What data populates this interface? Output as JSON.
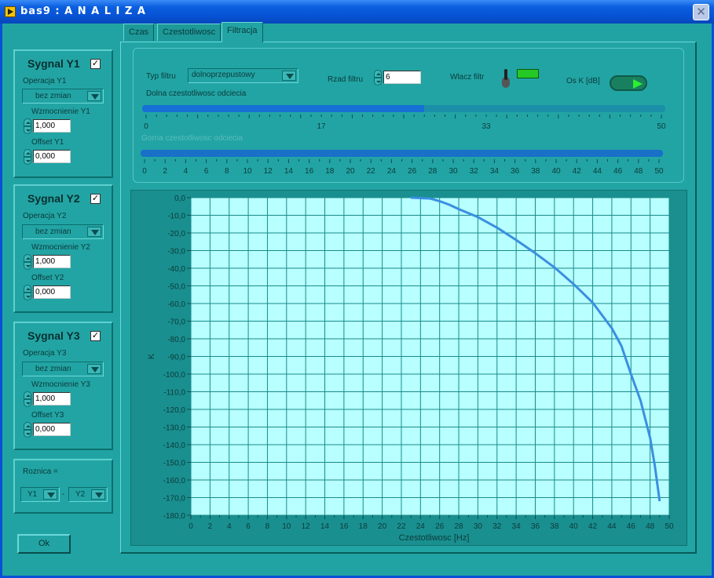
{
  "window": {
    "title": "bas9 : A N A L I Z A",
    "close_glyph": "✕"
  },
  "tabs": [
    {
      "label": "Czas",
      "active": false
    },
    {
      "label": "Czestotliwosc",
      "active": false
    },
    {
      "label": "Filtracja",
      "active": true
    }
  ],
  "signals": [
    {
      "title": "Sygnal Y1",
      "checked": true,
      "op_label": "Operacja Y1",
      "op_value": "bez zmian",
      "gain_label": "Wzmocnienie Y1",
      "gain_value": "1,000",
      "offset_label": "Offset Y1",
      "offset_value": "0,000"
    },
    {
      "title": "Sygnal Y2",
      "checked": true,
      "op_label": "Operacja Y2",
      "op_value": "bez zmian",
      "gain_label": "Wzmocnienie Y2",
      "gain_value": "1,000",
      "offset_label": "Offset Y2",
      "offset_value": "0,000"
    },
    {
      "title": "Sygnal Y3",
      "checked": true,
      "op_label": "Operacja Y3",
      "op_value": "bez zmian",
      "gain_label": "Wzmocnienie Y3",
      "gain_value": "1,000",
      "offset_label": "Offset Y3",
      "offset_value": "0,000"
    }
  ],
  "difference": {
    "label": "Roznica =",
    "left": "Y1",
    "separator": "-",
    "right": "Y2"
  },
  "ok_label": "Ok",
  "filter": {
    "type_label": "Typ filtru",
    "type_value": "dolnoprzepustowy",
    "order_label": "Rzad filtru",
    "order_value": "6",
    "enable_label": "Wlacz filtr",
    "axis_label": "Os K [dB]",
    "lower_cutoff_label": "Dolna czestotliwosc odciecia",
    "lower_cutoff_value": 27,
    "lower_ticks": [
      "0",
      "17",
      "33",
      "50"
    ],
    "upper_cutoff_label": "Gorna czestotliwosc odciecia",
    "upper_ticks": [
      "0",
      "2",
      "4",
      "6",
      "8",
      "10",
      "12",
      "14",
      "16",
      "18",
      "20",
      "22",
      "24",
      "26",
      "28",
      "30",
      "32",
      "34",
      "36",
      "38",
      "40",
      "42",
      "44",
      "46",
      "48",
      "50"
    ]
  },
  "chart_data": {
    "type": "line",
    "xlabel": "Czestotliwosc [Hz]",
    "ylabel": "K",
    "xlim": [
      0,
      50
    ],
    "ylim": [
      -180,
      0
    ],
    "x_ticks": [
      "0",
      "2",
      "4",
      "6",
      "8",
      "10",
      "12",
      "14",
      "16",
      "18",
      "20",
      "22",
      "24",
      "26",
      "28",
      "30",
      "32",
      "34",
      "36",
      "38",
      "40",
      "42",
      "44",
      "46",
      "48",
      "50"
    ],
    "y_ticks": [
      "0,0",
      "-10,0",
      "-20,0",
      "-30,0",
      "-40,0",
      "-50,0",
      "-60,0",
      "-70,0",
      "-80,0",
      "-90,0",
      "-100,0",
      "-110,0",
      "-120,0",
      "-130,0",
      "-140,0",
      "-150,0",
      "-160,0",
      "-170,0",
      "-180,0"
    ],
    "grid": true,
    "line_color": "#3a8fe0",
    "background_color": "#b8ffff",
    "series": [
      {
        "x": [
          23,
          25,
          26,
          27,
          28,
          30,
          32,
          34,
          36,
          38,
          40,
          42,
          44,
          45,
          46,
          47,
          48,
          48.5,
          49
        ],
        "y": [
          0,
          -0.5,
          -2,
          -4,
          -6.5,
          -11,
          -17,
          -24,
          -31.5,
          -39.5,
          -49,
          -59.5,
          -74,
          -84,
          -100,
          -115,
          -136,
          -152,
          -172
        ]
      }
    ]
  }
}
